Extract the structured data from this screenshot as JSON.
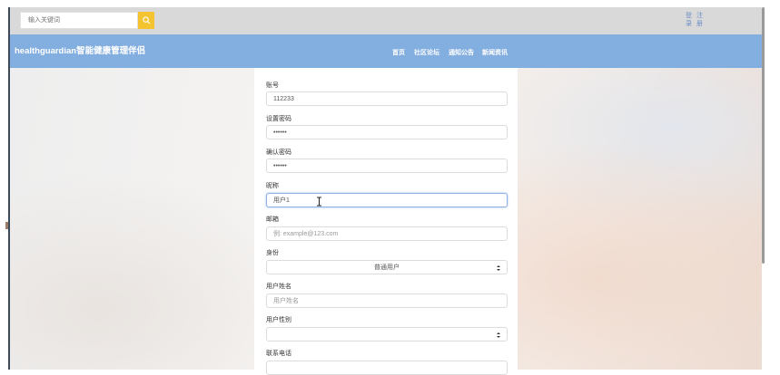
{
  "search": {
    "placeholder": "输入关键词"
  },
  "auth": {
    "login": "登录",
    "register": "注册"
  },
  "navbar": {
    "brand": "healthguardian智能健康管理伴侣",
    "links": [
      "首页",
      "社区论坛",
      "通知公告",
      "新闻资讯"
    ]
  },
  "form": {
    "account_label": "账号",
    "account_value": "112233",
    "password_label": "设置密码",
    "password_value": "123456",
    "confirm_label": "确认密码",
    "confirm_value": "123456",
    "nickname_label": "昵称",
    "nickname_value": "用户1",
    "email_label": "邮箱",
    "email_placeholder": "例: example@123.com",
    "identity_label": "身份",
    "identity_value": "普通用户",
    "realname_label": "用户姓名",
    "realname_placeholder": "用户姓名",
    "gender_label": "用户性别",
    "gender_value": "",
    "phone_label": "联系电话"
  },
  "colors": {
    "accent": "#f4c430",
    "nav": "#83aee0",
    "link": "#6a8dc8"
  }
}
